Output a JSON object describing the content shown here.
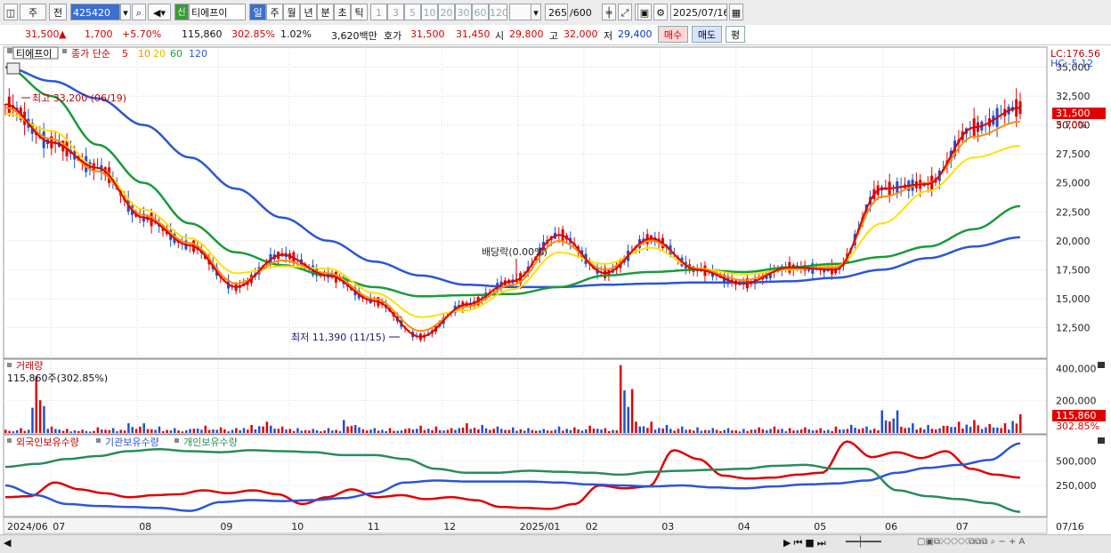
{
  "toolbar": {
    "market": "주",
    "range": "전",
    "code": "425420",
    "shin": "신",
    "name": "티에프이",
    "periods": [
      "일",
      "주",
      "월",
      "년",
      "분",
      "초",
      "틱"
    ],
    "intervals": [
      "1",
      "3",
      "5",
      "10",
      "20",
      "30",
      "60",
      "120"
    ],
    "count": "265",
    "count_total": "/600",
    "date": "2025/07/16"
  },
  "quote": {
    "price": "31,500",
    "arrow": "▲",
    "change": "1,700",
    "change_pct": "+5.70%",
    "volume": "115,860",
    "volume_ratio": "302.85%",
    "turnover": "1.02%",
    "amount": "3,620백만",
    "hoga_label": "호가",
    "ask": "31,500",
    "bid": "31,450",
    "open_label": "시",
    "open": "29,800",
    "high_label": "고",
    "high": "32,000",
    "low_label": "저",
    "low": "29,400",
    "buy_label": "매수",
    "sell_label": "매도",
    "pyeong_label": "평"
  },
  "legend": {
    "name": "티에프이",
    "ma_label": "종가 단순",
    "ma_periods": [
      "5",
      "10",
      "20",
      "60",
      "120"
    ],
    "lc": "LC:176.56",
    "hc": "HC:-5.12",
    "high_note": "최고 33,200 (06/19)",
    "low_note": "최저 11,390 (11/15)",
    "dividend_note": "배당락(0.00%)",
    "volume_title": "거래량",
    "volume_note": "115,860주(302.85%)",
    "holdings": [
      "외국인보유수량",
      "기관보유수량",
      "개인보유수량"
    ]
  },
  "badges": {
    "price": "31,500",
    "pct": "5.70%",
    "volume": "115,860",
    "volume_pct": "302.85%"
  },
  "colors": {
    "ma5": "#e00000",
    "ma10": "#ff8c00",
    "ma20": "#ffe000",
    "ma60": "#1a9a3a",
    "ma120": "#2b55d8",
    "up": "#e00000",
    "down": "#1f4fd0",
    "foreign": "#e00000",
    "inst": "#2b55d8",
    "indiv": "#2a8a5a"
  },
  "chart_data": [
    {
      "type": "line",
      "title": "티에프이",
      "x": [
        "2024/06",
        "07",
        "08",
        "09",
        "10",
        "11",
        "12",
        "2025/01",
        "02",
        "03",
        "04",
        "05",
        "06",
        "07"
      ],
      "ylim": [
        10000,
        36500
      ],
      "y_ticks": [
        "12,500",
        "15,000",
        "17,500",
        "20,000",
        "22,500",
        "25,000",
        "27,500",
        "30,000",
        "32,500",
        "35,000"
      ],
      "series": [
        {
          "name": "5",
          "values": [
            31800,
            28500,
            26300,
            22000,
            19600,
            16000,
            18800,
            17000,
            14800,
            11700,
            14500,
            16500,
            20500,
            17200,
            20200,
            17500,
            16300,
            17700,
            17500,
            24500,
            24900,
            29800,
            31500
          ]
        },
        {
          "name": "10",
          "values": [
            31500,
            28800,
            26000,
            22200,
            19800,
            16300,
            18300,
            17200,
            15000,
            12200,
            14300,
            16200,
            20000,
            17500,
            20000,
            17600,
            16600,
            17600,
            17700,
            23800,
            25000,
            29000,
            30300
          ]
        },
        {
          "name": "20",
          "values": [
            31000,
            29500,
            26300,
            22700,
            20200,
            17200,
            17800,
            17600,
            15500,
            13400,
            14000,
            15800,
            19000,
            18000,
            19400,
            17600,
            17100,
            17500,
            17800,
            21500,
            24300,
            27200,
            28200
          ]
        },
        {
          "name": "60",
          "values": [
            35000,
            32500,
            28300,
            25000,
            21500,
            19000,
            17900,
            17000,
            16000,
            15200,
            15300,
            15400,
            16000,
            17000,
            17300,
            17500,
            17300,
            17700,
            18000,
            18600,
            19500,
            21000,
            23000
          ]
        },
        {
          "name": "120",
          "values": [
            35000,
            33800,
            32300,
            30000,
            27200,
            24500,
            22000,
            20000,
            18200,
            17000,
            16200,
            16000,
            16000,
            16200,
            16300,
            16400,
            16400,
            16500,
            16800,
            17500,
            18500,
            19500,
            20300
          ]
        }
      ]
    },
    {
      "type": "bar",
      "title": "거래량",
      "ylim": [
        0,
        440000
      ],
      "y_ticks": [
        "200,000",
        "400,000"
      ],
      "values": [
        20000,
        30000,
        350000,
        40000,
        25000,
        20000,
        35000,
        30000,
        60000,
        40000,
        30000,
        25000,
        45000,
        35000,
        30000,
        50000,
        70000,
        40000,
        30000,
        25000,
        30000,
        80000,
        35000,
        30000,
        25000,
        45000,
        40000,
        30000,
        60000,
        50000,
        40000,
        35000,
        30000,
        25000,
        40000,
        35000,
        45000,
        30000,
        420000,
        70000,
        50000,
        40000,
        35000,
        30000,
        30000,
        25000,
        35000,
        40000,
        30000,
        35000,
        30000,
        40000,
        50000,
        40000,
        140000,
        60000,
        50000,
        45000,
        70000,
        80000,
        55000,
        60000,
        115860
      ]
    },
    {
      "type": "line",
      "title": "보유수량",
      "ylim": [
        -50000,
        750000
      ],
      "y_ticks": [
        "250,000",
        "500,000"
      ],
      "series": [
        {
          "name": "외국인보유수량",
          "values": [
            130000,
            140000,
            280000,
            210000,
            170000,
            130000,
            150000,
            160000,
            200000,
            170000,
            200000,
            160000,
            60000,
            130000,
            210000,
            130000,
            150000,
            110000,
            130000,
            100000,
            30000,
            20000,
            10000,
            60000,
            250000,
            220000,
            240000,
            610000,
            520000,
            350000,
            320000,
            330000,
            360000,
            380000,
            700000,
            540000,
            590000,
            530000,
            600000,
            420000,
            360000,
            330000
          ]
        },
        {
          "name": "기관보유수량",
          "values": [
            250000,
            150000,
            60000,
            40000,
            30000,
            20000,
            -10000,
            80000,
            100000,
            90000,
            100000,
            120000,
            170000,
            280000,
            300000,
            290000,
            290000,
            290000,
            280000,
            260000,
            250000,
            240000,
            250000,
            230000,
            220000,
            240000,
            260000,
            270000,
            300000,
            380000,
            430000,
            460000,
            510000,
            680000
          ]
        },
        {
          "name": "개인보유수량",
          "values": [
            440000,
            470000,
            520000,
            550000,
            600000,
            620000,
            600000,
            590000,
            610000,
            600000,
            590000,
            560000,
            560000,
            520000,
            420000,
            380000,
            380000,
            400000,
            390000,
            380000,
            360000,
            390000,
            400000,
            410000,
            420000,
            450000,
            460000,
            420000,
            420000,
            200000,
            140000,
            110000,
            70000,
            -20000
          ]
        }
      ]
    }
  ]
}
